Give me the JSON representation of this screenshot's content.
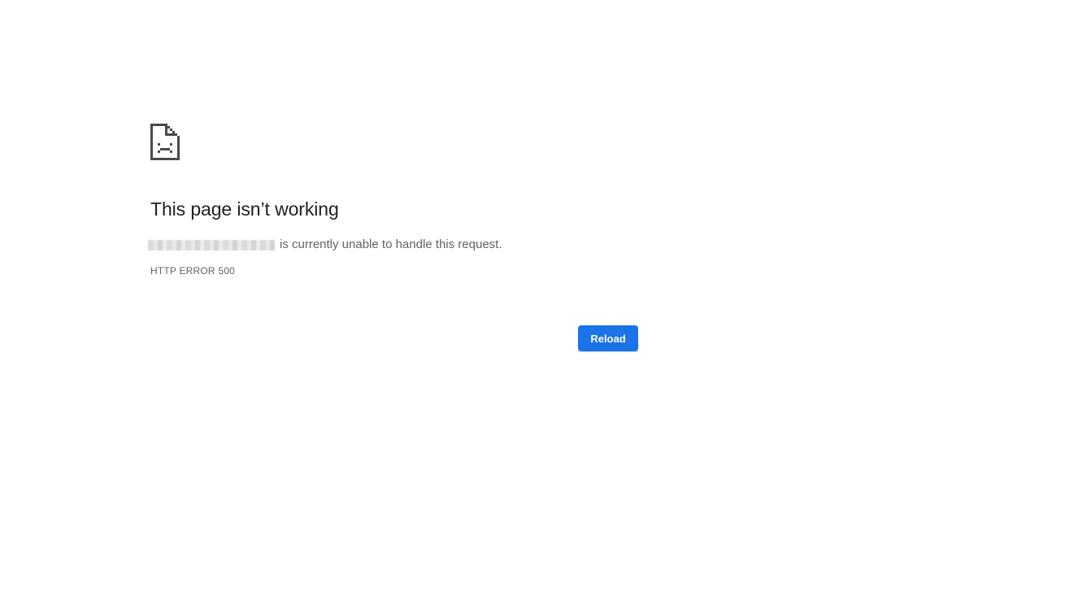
{
  "error": {
    "title": "This page isn’t working",
    "message_suffix": "is currently unable to handle this request.",
    "code": "HTTP ERROR 500",
    "icon": "sad-page-icon"
  },
  "actions": {
    "reload_label": "Reload"
  },
  "colors": {
    "accent": "#1a73e8",
    "title": "#202124",
    "secondary_text": "#5f6368",
    "icon": "#4a4a4a"
  }
}
